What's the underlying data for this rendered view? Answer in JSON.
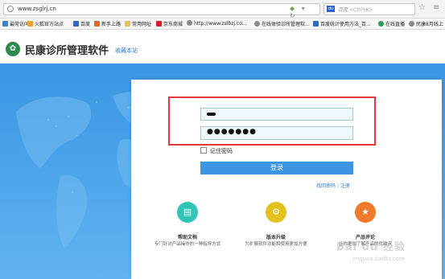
{
  "browser": {
    "url": "www.zsglrj.cn",
    "search_placeholder": "百度 <Ctrl+K>",
    "search_engine_label": "du"
  },
  "bookmarks": [
    {
      "label": "最常访问",
      "color": "#3e82d6"
    },
    {
      "label": "火狐官方站点",
      "color": "#f0a030"
    },
    {
      "label": "百度",
      "color": "#2f66d1"
    },
    {
      "label": "新手上路",
      "color": "#e46b1f"
    },
    {
      "label": "常用网址",
      "color": "#e8c050"
    },
    {
      "label": "京东商城",
      "color": "#d0242b"
    },
    {
      "label": "http://www.zslbzj.co...",
      "color": "#8a8a8a"
    },
    {
      "label": "在线体验诊所管理软...",
      "color": "#8a8a8a"
    },
    {
      "label": "百度统计使用方法_百...",
      "color": "#2f66d1"
    },
    {
      "label": "在线直播",
      "color": "#2a9d5c"
    },
    {
      "label": "民康8月线上",
      "color": "#8a8a8a"
    }
  ],
  "header": {
    "brand": "民康诊所管理软件",
    "fav_link": "收藏本站"
  },
  "login": {
    "password_mask": "●●●●●●●",
    "remember_label": "记住密码",
    "login_button": "登录",
    "forgot_link": "找回密码",
    "separator": "|",
    "register_link": "注册"
  },
  "features": [
    {
      "title": "帮助文档",
      "desc": "专门针对产品操作的一种指导方式",
      "color": "#2ec4b6",
      "icon": "document-icon"
    },
    {
      "title": "版本升级",
      "desc": "为扩展软件功能和使用更加方便",
      "color": "#e3c21f",
      "icon": "gear-icon"
    },
    {
      "title": "产品评论",
      "desc": "让你更加了解产品的优缺点",
      "color": "#f07a2a",
      "icon": "star-icon"
    }
  ],
  "watermark": {
    "text": "Bai du 经验",
    "sub": "jingyan.baidu.com"
  }
}
